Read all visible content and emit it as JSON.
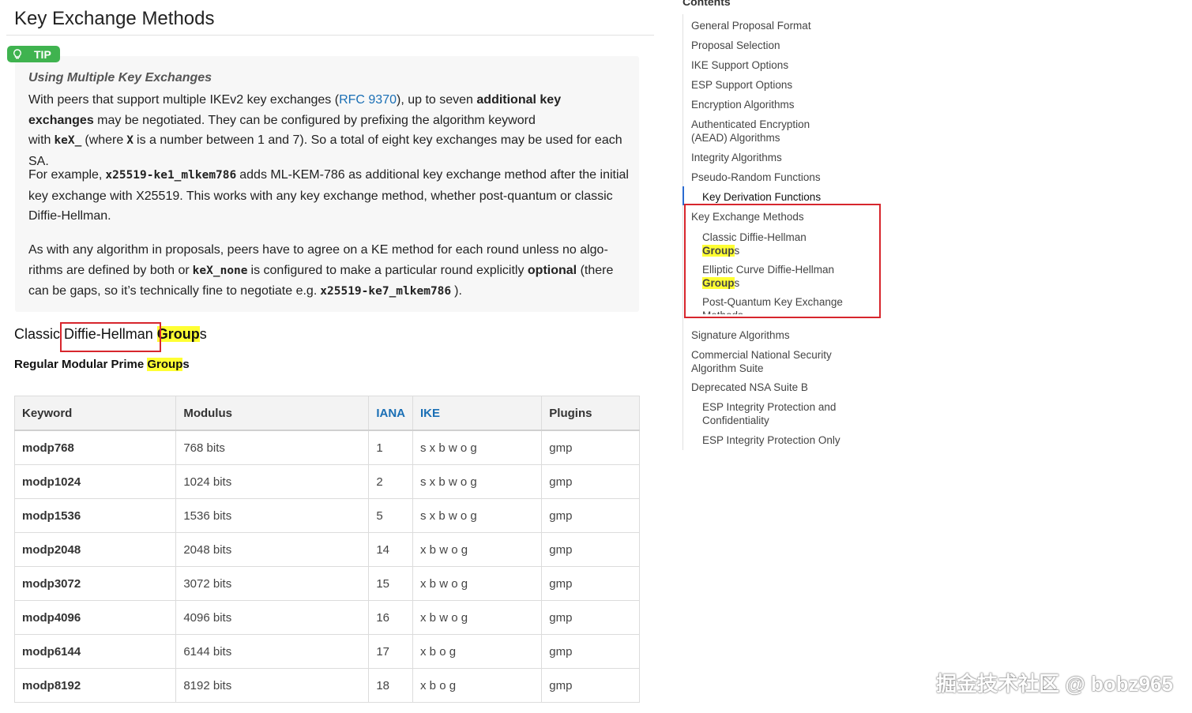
{
  "page_title": "Key Exchange Methods",
  "tip": {
    "badge": "TIP",
    "title": "Using Multiple Key Exchanges",
    "p1": {
      "a": "With peers that support multiple IKEv2 key exchanges (",
      "link": "RFC 9370",
      "b": "), up to seven ",
      "strong": "additional key exchanges",
      "c": " may be negotiated. They can be configured by prefixing the algorithm keyword with",
      "code1": "keX_",
      "d": "(where",
      "code2": "X",
      "e": "is a number between 1 and 7). So a total of eight key exchanges may be used for each SA."
    },
    "p2": {
      "a": "For example,",
      "code": "x25519-ke1_mlkem786",
      "b": "adds ML-KEM-786 as additional key exchange method after the ini­tial key exchange with X25519. This works with any key exchange method, whether post-quantum or clas­sic Diffie-Hellman."
    },
    "p3": {
      "a": "As with any algorithm in proposals, peers have to agree on a KE method for each round unless no algo­rithms are defined by both or",
      "code1": "keX_none",
      "b": "is configured to make a particular round explicitly ",
      "strong": "optional",
      "c": " (there can be gaps, so it’s technically fine to negotiate e.g.",
      "code2": "x25519-ke7_mlkem786",
      "d": ")."
    }
  },
  "section": {
    "h3_prefix": "Classic ",
    "h3_boxed": "Diffie-Hellman",
    "h3_space": " ",
    "h3_highlight": "Group",
    "h3_suffix": "s",
    "h4_prefix": "Regular Modular Prime ",
    "h4_highlight": "Group",
    "h4_suffix": "s"
  },
  "table": {
    "headers": [
      "Keyword",
      "Modulus",
      "IANA",
      "IKE",
      "Plugins"
    ],
    "rows": [
      [
        "modp768",
        "768 bits",
        "1",
        "s x b w o g",
        "gmp"
      ],
      [
        "modp1024",
        "1024 bits",
        "2",
        "s x b w o g",
        "gmp"
      ],
      [
        "modp1536",
        "1536 bits",
        "5",
        "s x b w o g",
        "gmp"
      ],
      [
        "modp2048",
        "2048 bits",
        "14",
        "x b w o g",
        "gmp"
      ],
      [
        "modp3072",
        "3072 bits",
        "15",
        "x b w o g",
        "gmp"
      ],
      [
        "modp4096",
        "4096 bits",
        "16",
        "x b w o g",
        "gmp"
      ],
      [
        "modp6144",
        "6144 bits",
        "17",
        "x b o g",
        "gmp"
      ],
      [
        "modp8192",
        "8192 bits",
        "18",
        "x b o g",
        "gmp"
      ]
    ]
  },
  "toc": {
    "heading": "Contents",
    "items": [
      {
        "label": "General Proposal Format"
      },
      {
        "label": "Proposal Selection"
      },
      {
        "label": "IKE Support Options"
      },
      {
        "label": "ESP Support Options"
      },
      {
        "label": "Encryption Algorithms"
      },
      {
        "label": "Authenticated Encryption (AEAD) Algorithms"
      },
      {
        "label": "Integrity Algorithms"
      },
      {
        "label": "Pseudo-Random Functions"
      },
      {
        "label": "Key Derivation Functions"
      },
      {
        "label": "Key Exchange Methods"
      },
      {
        "label_a": "Classic Diffie-Hellman",
        "label_hl": "Group",
        "label_b": "s"
      },
      {
        "label_a": "Elliptic Curve Diffie-Hellman",
        "label_hl": "Group",
        "label_b": "s"
      },
      {
        "label": "Post-Quantum Key Exchange Methods"
      },
      {
        "label": "Signature Algorithms"
      },
      {
        "label": "Commercial National Security Algorithm Suite"
      },
      {
        "label": "Deprecated NSA Suite B"
      },
      {
        "label": "ESP Integrity Protection and Confidentiality"
      },
      {
        "label": "ESP Integrity Protection Only"
      }
    ]
  },
  "watermark": "掘金技术社区 @ bobz965",
  "colors": {
    "highlight": "#ffff33",
    "annotation_box": "#d7262d",
    "tip_green": "#3fb34f",
    "link": "#1a6fb5"
  },
  "icons": {
    "tip": "lightbulb-icon"
  }
}
